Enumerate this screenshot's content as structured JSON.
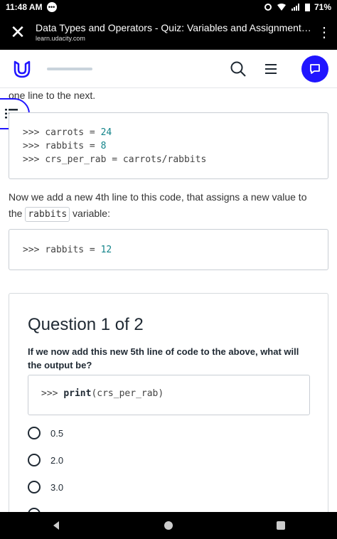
{
  "status_bar": {
    "time": "11:48 AM",
    "battery": "71%"
  },
  "browser": {
    "title": "Data Types and Operators - Quiz: Variables and Assignment Oper...",
    "url": "learn.udacity.com"
  },
  "content": {
    "intro_fragment": "one line to the next.",
    "code_block_1": {
      "lines": [
        {
          "prompt": ">>> ",
          "code": "carrots = ",
          "num": "24"
        },
        {
          "prompt": ">>> ",
          "code": "rabbits = ",
          "num": "8"
        },
        {
          "prompt": ">>> ",
          "code": "crs_per_rab = carrots/rabbits",
          "num": ""
        }
      ]
    },
    "paragraph_part1": "Now we add a new 4th line to this code, that assigns a new value to the",
    "paragraph_code": "rabbits",
    "paragraph_part2": "variable:",
    "code_block_2": {
      "prompt": ">>> ",
      "code": "rabbits = ",
      "num": "12"
    }
  },
  "quiz": {
    "heading": "Question 1 of 2",
    "question": "If we now add this new 5th line of code to the above, what will the output be?",
    "code_prompt": ">>> ",
    "code_func": "print",
    "code_args": "(crs_per_rab)",
    "options": [
      {
        "label": "0.5"
      },
      {
        "label": "2.0"
      },
      {
        "label": "3.0"
      }
    ]
  },
  "colors": {
    "accent": "#2015ff",
    "code_number": "#13848a"
  }
}
